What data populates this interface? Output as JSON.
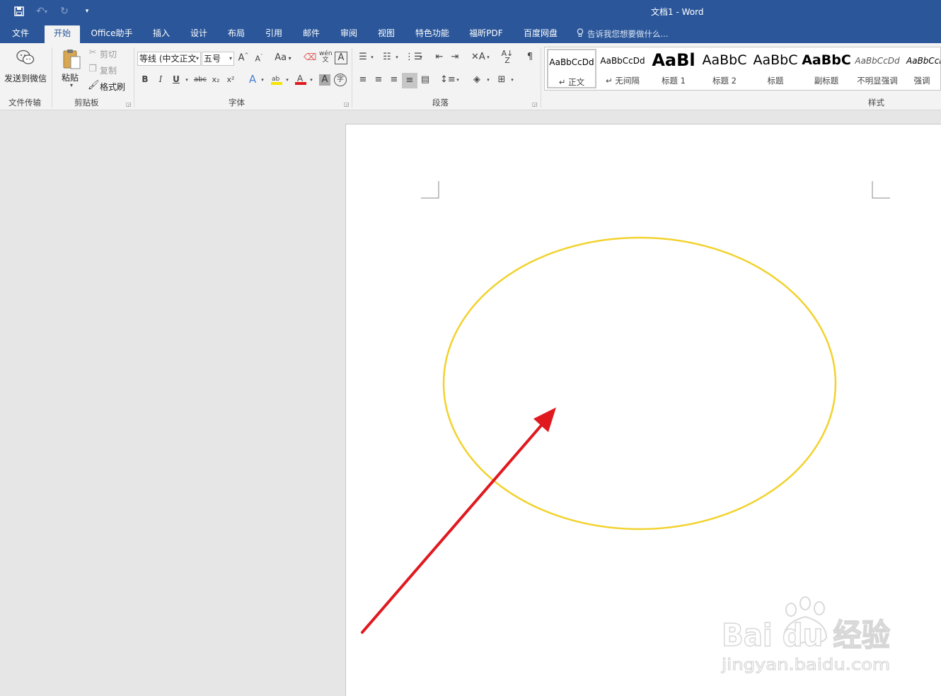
{
  "window": {
    "title": "文档1 - Word"
  },
  "qat": {
    "save_icon": "save-icon",
    "undo_icon": "undo-icon",
    "redo_icon": "redo-icon",
    "customize_icon": "customize-qat-icon"
  },
  "tabs": [
    {
      "label": "文件"
    },
    {
      "label": "开始"
    },
    {
      "label": "Office助手"
    },
    {
      "label": "插入"
    },
    {
      "label": "设计"
    },
    {
      "label": "布局"
    },
    {
      "label": "引用"
    },
    {
      "label": "邮件"
    },
    {
      "label": "审阅"
    },
    {
      "label": "视图"
    },
    {
      "label": "特色功能"
    },
    {
      "label": "福昕PDF"
    },
    {
      "label": "百度网盘"
    }
  ],
  "active_tab": "开始",
  "tell_me": {
    "placeholder": "告诉我您想要做什么..."
  },
  "ribbon": {
    "file_transfer": {
      "send_wechat": "发送到微信",
      "group_label": "文件传输"
    },
    "clipboard": {
      "paste": "粘贴",
      "cut": "剪切",
      "copy": "复制",
      "format_painter": "格式刷",
      "group_label": "剪贴板"
    },
    "font": {
      "font_name": "等线 (中文正文",
      "font_size": "五号",
      "bold": "B",
      "italic": "I",
      "underline": "U",
      "strike": "abc",
      "subscript": "x₂",
      "superscript": "x²",
      "change_case": "Aa",
      "char_border": "A",
      "group_label": "字体"
    },
    "paragraph": {
      "group_label": "段落"
    },
    "styles": {
      "group_label": "样式",
      "items": [
        {
          "sample": "AaBbCcDd",
          "name": "↵ 正文"
        },
        {
          "sample": "AaBbCcDd",
          "name": "↵ 无间隔"
        },
        {
          "sample": "AaBl",
          "name": "标题 1"
        },
        {
          "sample": "AaBbC",
          "name": "标题 2"
        },
        {
          "sample": "AaBbC",
          "name": "标题"
        },
        {
          "sample": "AaBbC",
          "name": "副标题"
        },
        {
          "sample": "AaBbCcDd",
          "name": "不明显强调"
        },
        {
          "sample": "AaBbCcDd",
          "name": "强调"
        }
      ]
    }
  },
  "watermark": {
    "brand": "Bai du 经验",
    "url": "jingyan.baidu.com"
  },
  "colors": {
    "title_bar": "#2b579a",
    "ellipse": "#f2d22e",
    "arrow": "#e0191f"
  }
}
